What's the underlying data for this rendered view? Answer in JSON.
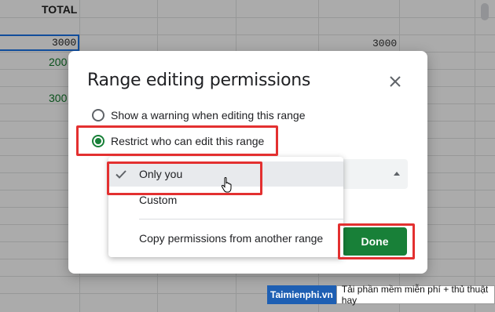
{
  "sheet": {
    "header_total": "TOTAL",
    "cell_selected": "3000",
    "cell_right": "3000",
    "cell_left_1": "200",
    "cell_left_2": "300"
  },
  "dialog": {
    "title": "Range editing permissions",
    "radio_warning_label": "Show a warning when editing this range",
    "radio_restrict_label": "Restrict who can edit this range",
    "done_label": "Done"
  },
  "menu": {
    "items": [
      {
        "label": "Only you",
        "checked": true
      },
      {
        "label": "Custom",
        "checked": false
      },
      {
        "label": "Copy permissions from another range",
        "checked": false
      }
    ]
  },
  "watermark": {
    "brand": "Taimienphi.vn",
    "tagline": "Tải phần mềm miễn phí + thủ thuật hay"
  },
  "icons": {
    "close": "close-icon",
    "check": "check-icon",
    "dropdown": "caret-up-icon",
    "cursor": "hand-pointer-icon"
  },
  "colors": {
    "accent_green": "#188038",
    "annotation_red": "#e33030",
    "selection_blue": "#1a73e8"
  }
}
